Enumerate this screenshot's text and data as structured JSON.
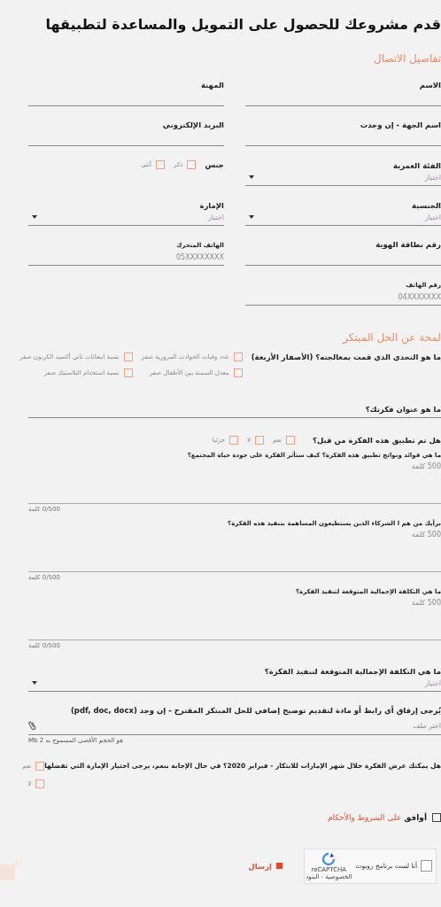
{
  "title": "قدم مشروعك للحصول على التمويل والمساعدة لتطبيقها",
  "contact": {
    "heading": "تفاصيل الاتصال",
    "fields": [
      {
        "kind": "text",
        "label": "الاسم"
      },
      {
        "kind": "text",
        "label": "المهنة"
      },
      {
        "kind": "text",
        "label": "اسم الجهة - إن وجدت"
      },
      {
        "kind": "text",
        "label": "البريد الإلكتروني"
      },
      {
        "kind": "select",
        "label": "الفئة العمرية",
        "placeholder": "اختيار"
      },
      {
        "kind": "choice",
        "label": "جنس",
        "options": [
          {
            "label": "ذكر",
            "checked": false
          },
          {
            "label": "أنثى",
            "checked": false
          }
        ]
      },
      {
        "kind": "select",
        "label": "الجنسية",
        "placeholder": "اختيار"
      },
      {
        "kind": "select",
        "label": "الإمارة",
        "placeholder": "اختيار"
      },
      {
        "kind": "text",
        "label": "رقم بطاقة الهوية"
      },
      {
        "kind": "tel",
        "label": "الهاتف المتحرك",
        "placeholder": "05XXXXXXXX"
      },
      {
        "kind": "tel",
        "label": "رقم الهاتف",
        "placeholder": "04XXXXXXX"
      }
    ]
  },
  "idea": {
    "heading": "لمحة عن الحل المبتكر",
    "challenge": {
      "label": "ما هو التحدي الذي قمت بمعالجته؟ (الأصفار الأربعة)",
      "options": [
        {
          "label": "عدد وفيات الحوادث المرورية صفر",
          "checked": false
        },
        {
          "label": "نسبة انبعاثات ثاني أكسيد الكربون صفر",
          "checked": false
        },
        {
          "label": "معدل السمنة بين الأطفال صفر",
          "checked": false
        },
        {
          "label": "نسبة استخدام البلاستيك صفر",
          "checked": false
        }
      ]
    },
    "title_field": {
      "label": "ما هو عنوان فكرتك؟"
    },
    "applied": {
      "label": "هل تم تطبيق هذه الفكرة من قبل؟",
      "options": [
        {
          "label": "نعم",
          "checked": false
        },
        {
          "label": "لا",
          "checked": false
        },
        {
          "label": "جزئيا",
          "checked": false
        }
      ]
    },
    "textareas": [
      {
        "label": "ما هي فوائد ونواتج تطبيق هذه الفكرة؟ كيف ستأثر الفكرة على جودة حياة المجتمع؟",
        "placeholder": "500 كلمة",
        "counter": "0/500 كلمة"
      },
      {
        "label": "برأيك من هم ا الشركاء الذين يستطيعون المساهمة بتنفيذ هذه الفكرة؟",
        "placeholder": "500 كلمة",
        "counter": "0/500 كلمة"
      },
      {
        "label": "ما هي التكلفة الإجمالية المتوقعة لتنفيذ الفكرة؟",
        "placeholder": "500 كلمة",
        "counter": "0/500 كلمة"
      }
    ],
    "cost": {
      "label": "ما هي التكلفة الإجمالية المتوقعة لتنفيذ الفكرة؟",
      "placeholder": "اختيار"
    },
    "file": {
      "label": "يُرجى إرفاق أي رابط أو مادة لتقديم توضيح إضافي للحل المبتكر المقترح - إن وجد (pdf, doc, docx)",
      "placeholder": "اختر ملف",
      "note": "هو الحجم الأقصى المسموح به 2 Mb"
    },
    "exhibit": {
      "label": "هل يمكنك عرض الفكرة خلال شهر الإمارات للابتكار - فبراير 2020؟ في حال الإجابة بنعم، يرجى اختيار الإمارة التي تفضلها",
      "options": [
        {
          "label": "نعم",
          "checked": false
        },
        {
          "label": "لا",
          "checked": false
        }
      ]
    }
  },
  "terms": {
    "text": "أوافق",
    "link": "على الشروط والأحكام",
    "checked": false
  },
  "captcha": {
    "label": "أنا لست برنامج روبوت",
    "brand": "reCAPTCHA",
    "links": "الخصوصية - البنود",
    "checked": false
  },
  "submit": "إرسال"
}
